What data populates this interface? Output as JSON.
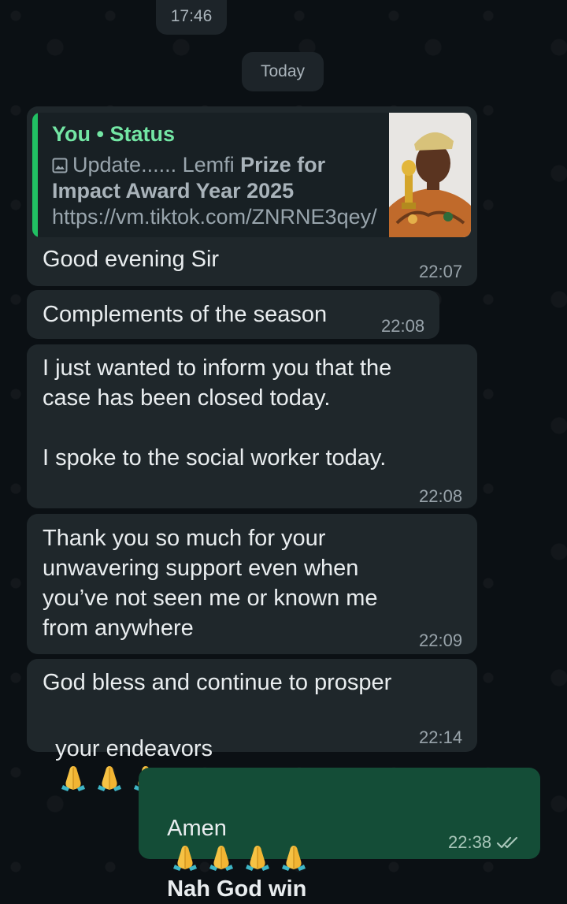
{
  "chat": {
    "top_time": "17:46",
    "date_divider": "Today"
  },
  "messages": {
    "m1": {
      "quote": {
        "author": "You • Status",
        "icon": "image-icon",
        "text_normal_1": "Update...... Lemfi ",
        "text_bold": "Prize for Impact Award Year 2025",
        "text_normal_2": " https://vm.tiktok.com/ZNRNE3qey/"
      },
      "text": "Good evening Sir",
      "time": "22:07"
    },
    "m2": {
      "text": "Complements of the season",
      "time": "22:08"
    },
    "m3": {
      "text": "I just wanted to inform you that the\ncase has been closed today.\n\nI spoke to the social worker today.",
      "time": "22:08"
    },
    "m4": {
      "text": "Thank you so much for your\nunwavering support even when\nyou’ve not seen me or known me\nfrom anywhere",
      "time": "22:09"
    },
    "m5": {
      "text_line1": "God bless and continue to prosper",
      "text_line2": "your endeavors",
      "emoji": "folded-hands",
      "emoji_count": 3,
      "time": "22:14"
    },
    "m6": {
      "text_plain": "Amen",
      "emoji": "folded-hands",
      "emoji_count": 4,
      "text_bold": "Nah God win",
      "time": "22:38",
      "status": "read-double-tick"
    }
  },
  "colors": {
    "background": "#0b1014",
    "incoming_bubble": "#1f272b",
    "outgoing_bubble": "#144d37",
    "quote_accent": "#21c063",
    "quote_author": "#73e6a4"
  }
}
